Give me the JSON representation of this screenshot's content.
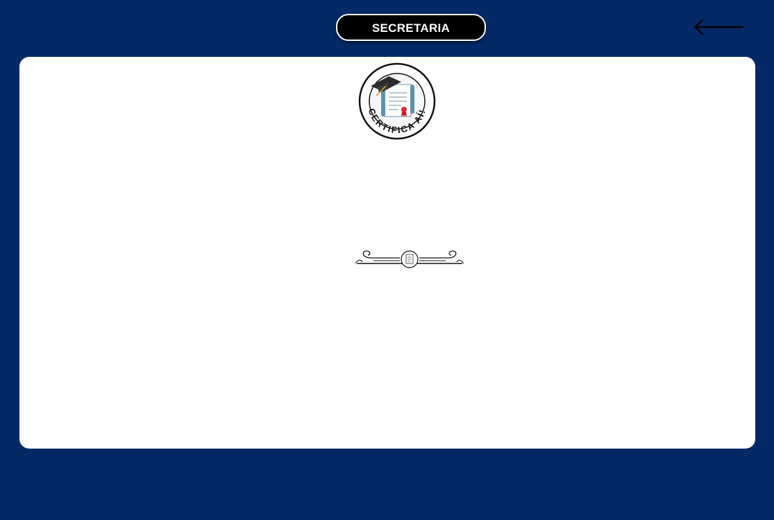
{
  "header": {
    "title": "SECRETARIA",
    "back_icon": "arrow-left-icon"
  },
  "logo": {
    "text": "CERTIFICA AÍ!",
    "icon": "certificate-graduation-logo"
  },
  "divider": {
    "icon": "ornamental-divider-icon"
  },
  "colors": {
    "background": "#032a66",
    "panel": "#ffffff",
    "pill": "#000000",
    "ribbon_red": "#e02a2a"
  }
}
